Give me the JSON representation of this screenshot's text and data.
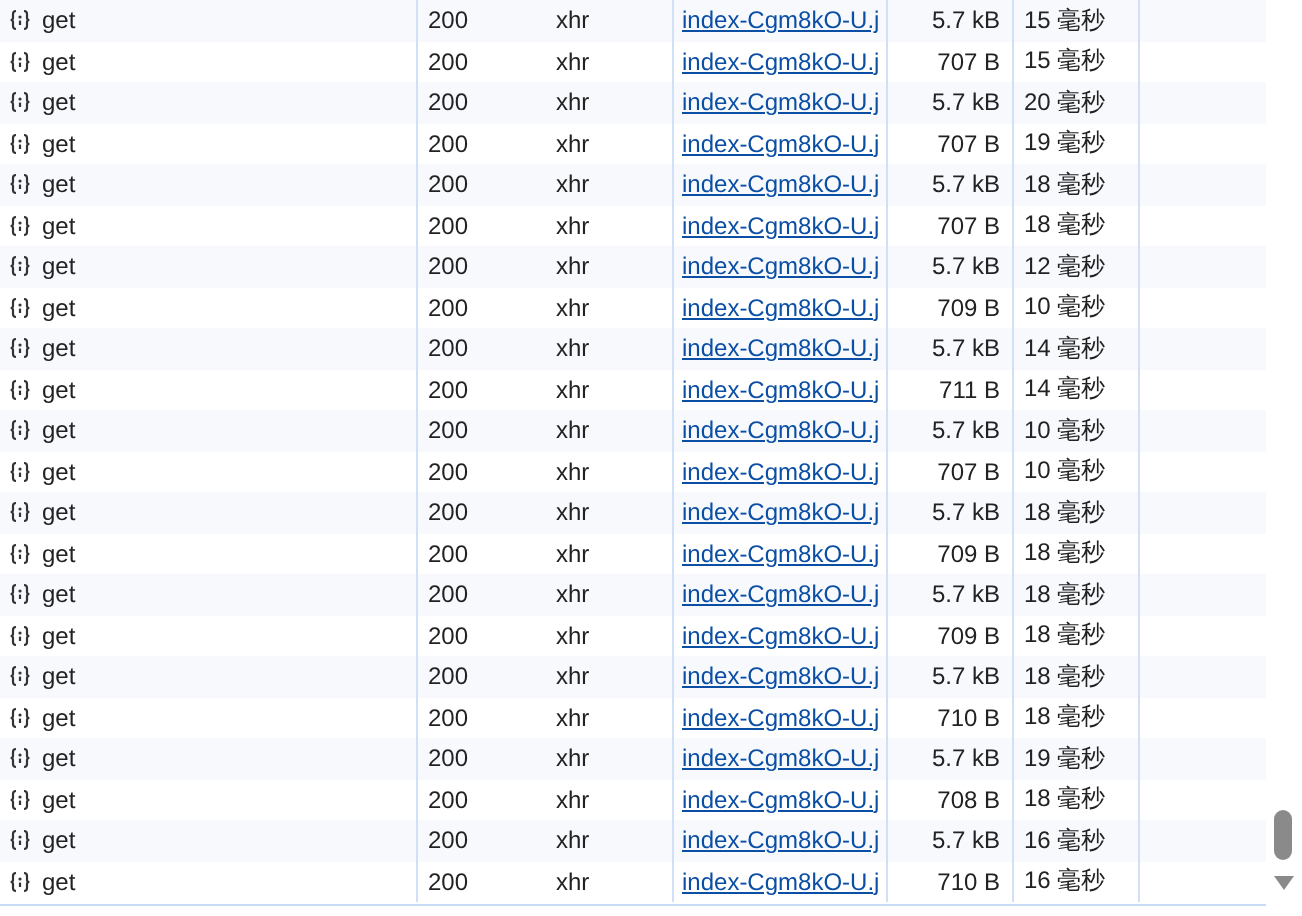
{
  "requests": [
    {
      "name": "get",
      "status": "200",
      "type": "xhr",
      "file": "index-Cgm8kO-U.j",
      "size": "5.7 kB",
      "time": "15 毫秒"
    },
    {
      "name": "get",
      "status": "200",
      "type": "xhr",
      "file": "index-Cgm8kO-U.j",
      "size": "707 B",
      "time": "15 毫秒"
    },
    {
      "name": "get",
      "status": "200",
      "type": "xhr",
      "file": "index-Cgm8kO-U.j",
      "size": "5.7 kB",
      "time": "20 毫秒"
    },
    {
      "name": "get",
      "status": "200",
      "type": "xhr",
      "file": "index-Cgm8kO-U.j",
      "size": "707 B",
      "time": "19 毫秒"
    },
    {
      "name": "get",
      "status": "200",
      "type": "xhr",
      "file": "index-Cgm8kO-U.j",
      "size": "5.7 kB",
      "time": "18 毫秒"
    },
    {
      "name": "get",
      "status": "200",
      "type": "xhr",
      "file": "index-Cgm8kO-U.j",
      "size": "707 B",
      "time": "18 毫秒"
    },
    {
      "name": "get",
      "status": "200",
      "type": "xhr",
      "file": "index-Cgm8kO-U.j",
      "size": "5.7 kB",
      "time": "12 毫秒"
    },
    {
      "name": "get",
      "status": "200",
      "type": "xhr",
      "file": "index-Cgm8kO-U.j",
      "size": "709 B",
      "time": "10 毫秒"
    },
    {
      "name": "get",
      "status": "200",
      "type": "xhr",
      "file": "index-Cgm8kO-U.j",
      "size": "5.7 kB",
      "time": "14 毫秒"
    },
    {
      "name": "get",
      "status": "200",
      "type": "xhr",
      "file": "index-Cgm8kO-U.j",
      "size": "711 B",
      "time": "14 毫秒"
    },
    {
      "name": "get",
      "status": "200",
      "type": "xhr",
      "file": "index-Cgm8kO-U.j",
      "size": "5.7 kB",
      "time": "10 毫秒"
    },
    {
      "name": "get",
      "status": "200",
      "type": "xhr",
      "file": "index-Cgm8kO-U.j",
      "size": "707 B",
      "time": "10 毫秒"
    },
    {
      "name": "get",
      "status": "200",
      "type": "xhr",
      "file": "index-Cgm8kO-U.j",
      "size": "5.7 kB",
      "time": "18 毫秒"
    },
    {
      "name": "get",
      "status": "200",
      "type": "xhr",
      "file": "index-Cgm8kO-U.j",
      "size": "709 B",
      "time": "18 毫秒"
    },
    {
      "name": "get",
      "status": "200",
      "type": "xhr",
      "file": "index-Cgm8kO-U.j",
      "size": "5.7 kB",
      "time": "18 毫秒"
    },
    {
      "name": "get",
      "status": "200",
      "type": "xhr",
      "file": "index-Cgm8kO-U.j",
      "size": "709 B",
      "time": "18 毫秒"
    },
    {
      "name": "get",
      "status": "200",
      "type": "xhr",
      "file": "index-Cgm8kO-U.j",
      "size": "5.7 kB",
      "time": "18 毫秒"
    },
    {
      "name": "get",
      "status": "200",
      "type": "xhr",
      "file": "index-Cgm8kO-U.j",
      "size": "710 B",
      "time": "18 毫秒"
    },
    {
      "name": "get",
      "status": "200",
      "type": "xhr",
      "file": "index-Cgm8kO-U.j",
      "size": "5.7 kB",
      "time": "19 毫秒"
    },
    {
      "name": "get",
      "status": "200",
      "type": "xhr",
      "file": "index-Cgm8kO-U.j",
      "size": "708 B",
      "time": "18 毫秒"
    },
    {
      "name": "get",
      "status": "200",
      "type": "xhr",
      "file": "index-Cgm8kO-U.j",
      "size": "5.7 kB",
      "time": "16 毫秒"
    },
    {
      "name": "get",
      "status": "200",
      "type": "xhr",
      "file": "index-Cgm8kO-U.j",
      "size": "710 B",
      "time": "16 毫秒"
    }
  ]
}
